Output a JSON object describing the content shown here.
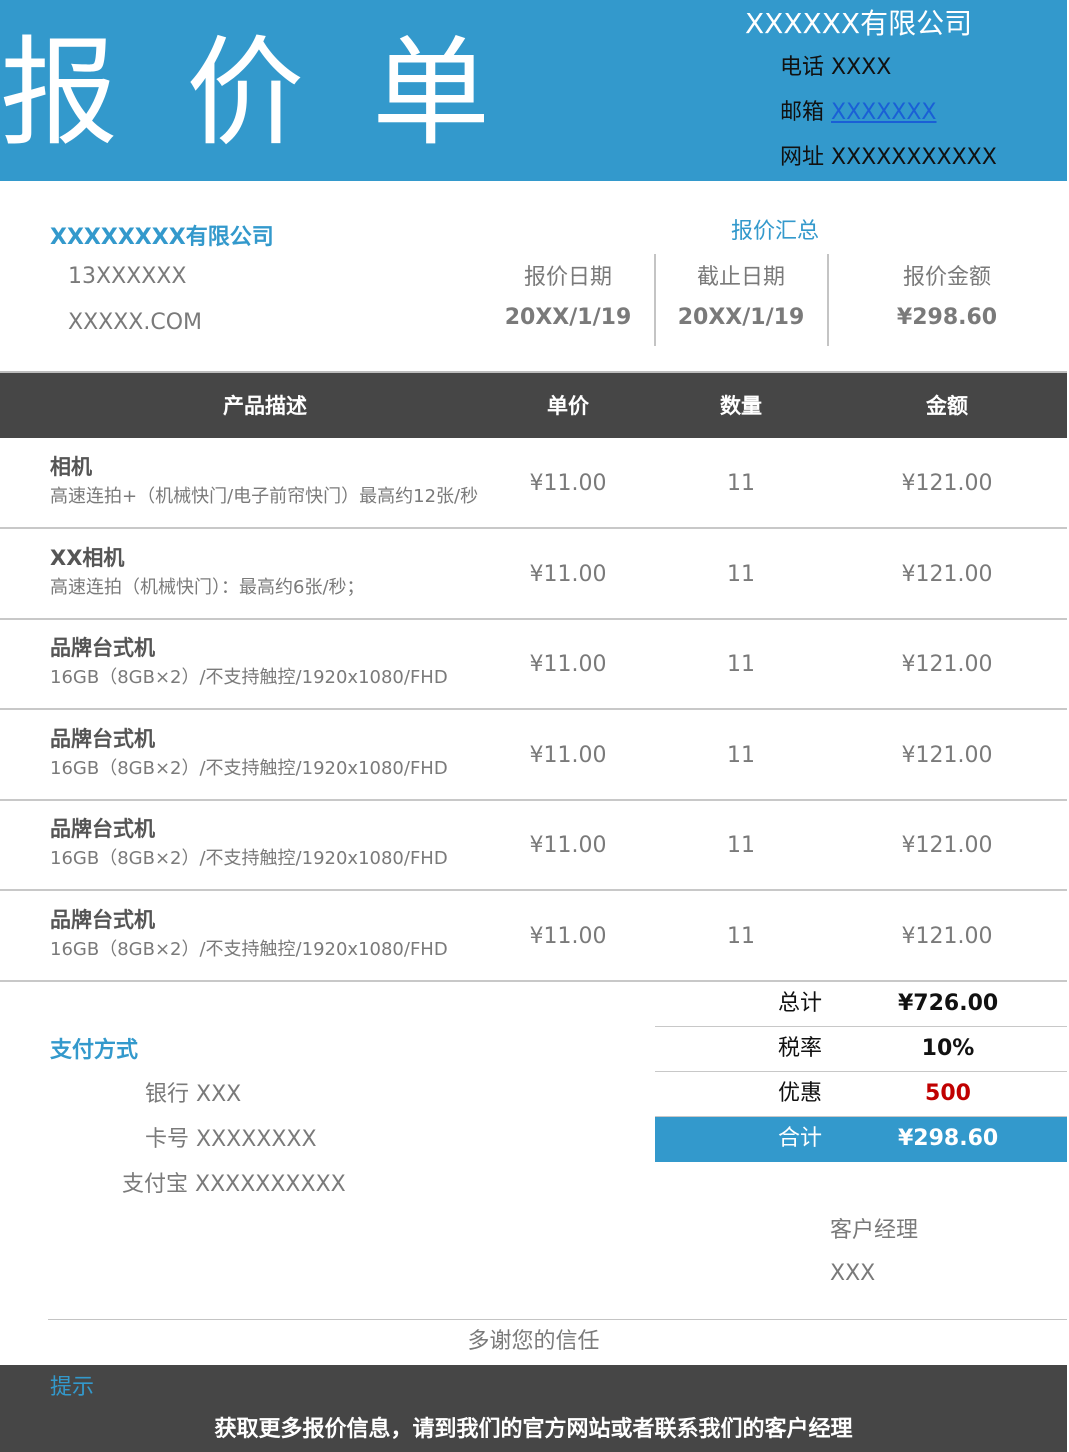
{
  "header": {
    "title_chars": [
      "报",
      "价",
      "单"
    ],
    "company": "XXXXXX有限公司",
    "phone": "电话 XXXX",
    "email_label": "邮箱 ",
    "email_value": "XXXXXXX",
    "website": "网址 XXXXXXXXXXX",
    "band_color": "#3399cc"
  },
  "client": {
    "name": "XXXXXXXX有限公司",
    "phone": "13XXXXXX",
    "website": "XXXXX.COM"
  },
  "summary": {
    "title": "报价汇总",
    "quote_date_label": "报价日期",
    "quote_date": "20XX/1/19",
    "deadline_label": "截止日期",
    "deadline": "20XX/1/19",
    "amount_label": "报价金额",
    "amount": "¥298.60"
  },
  "table": {
    "headers": [
      "产品描述",
      "单价",
      "数量",
      "金额"
    ],
    "rows": [
      {
        "name": "相机",
        "desc": "高速连拍+（机械快门/电子前帘快门）最高约12张/秒",
        "price": "¥11.00",
        "qty": "11",
        "amount": "¥121.00"
      },
      {
        "name": "XX相机",
        "desc": "高速连拍（机械快门）：最高约6张/秒；",
        "price": "¥11.00",
        "qty": "11",
        "amount": "¥121.00"
      },
      {
        "name": "品牌台式机",
        "desc": "16GB（8GB×2）/不支持触控/1920x1080/FHD",
        "price": "¥11.00",
        "qty": "11",
        "amount": "¥121.00"
      },
      {
        "name": "品牌台式机",
        "desc": "16GB（8GB×2）/不支持触控/1920x1080/FHD",
        "price": "¥11.00",
        "qty": "11",
        "amount": "¥121.00"
      },
      {
        "name": "品牌台式机",
        "desc": "16GB（8GB×2）/不支持触控/1920x1080/FHD",
        "price": "¥11.00",
        "qty": "11",
        "amount": "¥121.00"
      },
      {
        "name": "品牌台式机",
        "desc": "16GB（8GB×2）/不支持触控/1920x1080/FHD",
        "price": "¥11.00",
        "qty": "11",
        "amount": "¥121.00"
      }
    ]
  },
  "payment": {
    "title": "支付方式",
    "bank": "银行 XXX",
    "card": "卡号 XXXXXXXX",
    "alipay": "支付宝 XXXXXXXXXX"
  },
  "totals": {
    "subtotal_label": "总计",
    "subtotal": "¥726.00",
    "tax_label": "税率",
    "tax": "10%",
    "discount_label": "优惠",
    "discount": "500",
    "total_label": "合计",
    "total": "¥298.60",
    "discount_color": "#c00000"
  },
  "manager": {
    "label": "客户经理",
    "name": "XXX"
  },
  "thanks": "多谢您的信任",
  "footer": {
    "tip_title": "提示",
    "tip_text": "获取更多报价信息，请到我们的官方网站或者联系我们的客户经理"
  }
}
